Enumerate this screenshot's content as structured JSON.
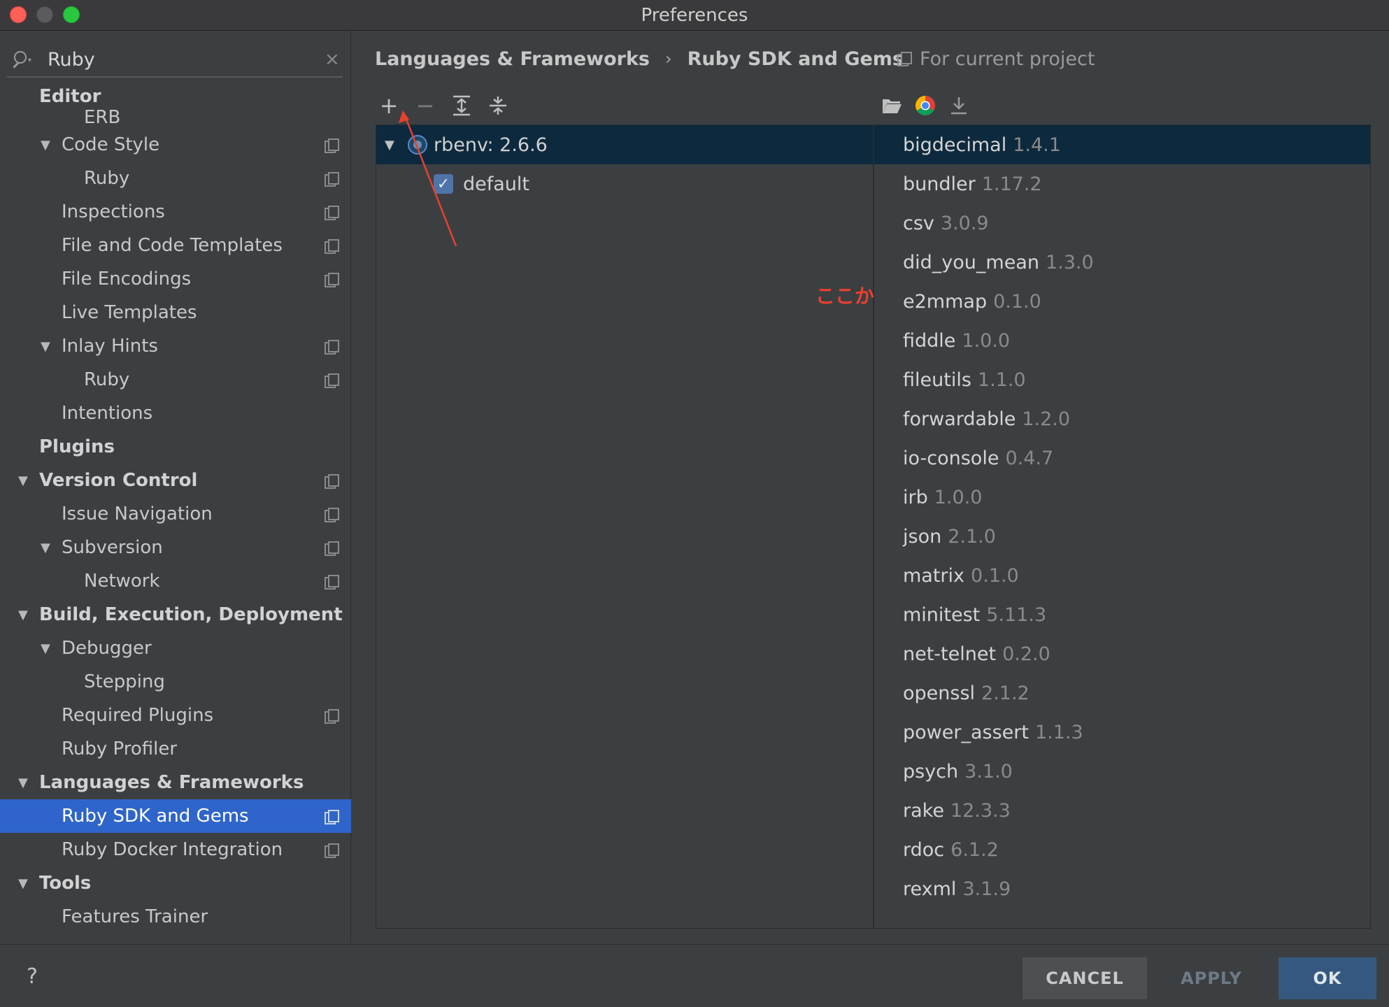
{
  "window": {
    "title": "Preferences",
    "traffic_lights": [
      "close",
      "minimize",
      "maximize"
    ]
  },
  "search": {
    "value": "Ruby",
    "clear_glyph": "×"
  },
  "sidebar": {
    "items": [
      {
        "label": "Editor"
      },
      {
        "label": "ERB"
      },
      {
        "label": "Code Style"
      },
      {
        "label": "Ruby"
      },
      {
        "label": "Inspections"
      },
      {
        "label": "File and Code Templates"
      },
      {
        "label": "File Encodings"
      },
      {
        "label": "Live Templates"
      },
      {
        "label": "Inlay Hints"
      },
      {
        "label": "Ruby"
      },
      {
        "label": "Intentions"
      },
      {
        "label": "Plugins"
      },
      {
        "label": "Version Control"
      },
      {
        "label": "Issue Navigation"
      },
      {
        "label": "Subversion"
      },
      {
        "label": "Network"
      },
      {
        "label": "Build, Execution, Deployment"
      },
      {
        "label": "Debugger"
      },
      {
        "label": "Stepping"
      },
      {
        "label": "Required Plugins"
      },
      {
        "label": "Ruby Profiler"
      },
      {
        "label": "Languages & Frameworks"
      },
      {
        "label": "Ruby SDK and Gems"
      },
      {
        "label": "Ruby Docker Integration"
      },
      {
        "label": "Tools"
      },
      {
        "label": "Features Trainer"
      }
    ]
  },
  "header": {
    "breadcrumb": [
      "Languages & Frameworks",
      "Ruby SDK and Gems"
    ],
    "breadcrumb_sep": "›",
    "scope": "For current project"
  },
  "toolbar": {
    "add": "+",
    "remove": "−",
    "expand_all": "expand-all-icon",
    "collapse_all": "collapse-all-icon",
    "folder": "folder-icon",
    "browser": "chrome-icon",
    "install": "download-icon"
  },
  "sdk_tree": {
    "sdk": "rbenv: 2.6.6",
    "gemset": "default"
  },
  "annotation": "ここからRubyのPathを追加出来る",
  "gems": [
    {
      "name": "bigdecimal",
      "version": "1.4.1"
    },
    {
      "name": "bundler",
      "version": "1.17.2"
    },
    {
      "name": "csv",
      "version": "3.0.9"
    },
    {
      "name": "did_you_mean",
      "version": "1.3.0"
    },
    {
      "name": "e2mmap",
      "version": "0.1.0"
    },
    {
      "name": "fiddle",
      "version": "1.0.0"
    },
    {
      "name": "fileutils",
      "version": "1.1.0"
    },
    {
      "name": "forwardable",
      "version": "1.2.0"
    },
    {
      "name": "io-console",
      "version": "0.4.7"
    },
    {
      "name": "irb",
      "version": "1.0.0"
    },
    {
      "name": "json",
      "version": "2.1.0"
    },
    {
      "name": "matrix",
      "version": "0.1.0"
    },
    {
      "name": "minitest",
      "version": "5.11.3"
    },
    {
      "name": "net-telnet",
      "version": "0.2.0"
    },
    {
      "name": "openssl",
      "version": "2.1.2"
    },
    {
      "name": "power_assert",
      "version": "1.1.3"
    },
    {
      "name": "psych",
      "version": "3.1.0"
    },
    {
      "name": "rake",
      "version": "12.3.3"
    },
    {
      "name": "rdoc",
      "version": "6.1.2"
    },
    {
      "name": "rexml",
      "version": "3.1.9"
    }
  ],
  "footer": {
    "help": "?",
    "cancel": "CANCEL",
    "apply": "APPLY",
    "ok": "OK"
  },
  "colors": {
    "selection": "#2f65ca",
    "annotation": "#e8402f",
    "ok_button": "#365880"
  }
}
